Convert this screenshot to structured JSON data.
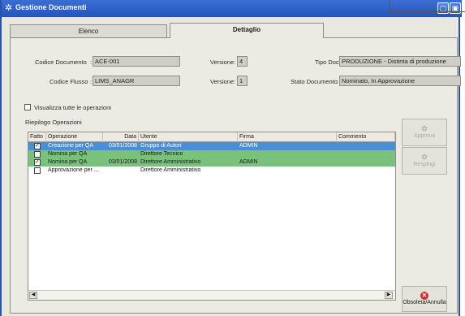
{
  "window": {
    "title": "Gestione Documenti",
    "controls": [
      "minimize-icon",
      "close-icon"
    ]
  },
  "tabs": [
    {
      "label": "Elenco",
      "active": false
    },
    {
      "label": "Dettaglio",
      "active": true
    }
  ],
  "form": {
    "codice_documento": {
      "label": "Codice Documento",
      "value": "ACE-001"
    },
    "codice_flusso": {
      "label": "Codice Flusso",
      "value": "LIMS_ANAGR"
    },
    "versione1": {
      "label": "Versione",
      "value": "4"
    },
    "versione2": {
      "label": "Versione",
      "value": "1"
    },
    "tipo_doc": {
      "label": "Tipo Doc",
      "value": "PRODUZIONE - Distinta di produzione"
    },
    "stato_documento": {
      "label": "Stato Documento",
      "value": "Nominato, In Approvazione"
    }
  },
  "visualizza_checkbox": {
    "label": "Visualizza tutte le operazioni",
    "checked": false
  },
  "riepilogo_label": "Riepilogo Operazioni",
  "table": {
    "headers": {
      "fatto": "Fatto",
      "operazione": "Operazione",
      "data": "Data",
      "utente": "Utente",
      "firma": "Firma",
      "commento": "Commento"
    },
    "rows": [
      {
        "fatto": true,
        "operazione": "Creazione per QA",
        "data": "03/01/2008",
        "utente": "Gruppo di Autori",
        "firma": "ADMIN",
        "commento": "",
        "style": "selected"
      },
      {
        "fatto": false,
        "operazione": "Nomina per QA",
        "data": "",
        "utente": "Direttore Tecnico",
        "firma": "",
        "commento": "",
        "style": "green"
      },
      {
        "fatto": true,
        "operazione": "Nomina per QA",
        "data": "03/01/2008",
        "utente": "Direttore Amministrativo",
        "firma": "ADMIN",
        "commento": "",
        "style": "green"
      },
      {
        "fatto": false,
        "operazione": "Approvazione per ...",
        "data": "",
        "utente": "Direttore Amministrativo",
        "firma": "",
        "commento": "",
        "style": "plain"
      }
    ]
  },
  "buttons": {
    "approva": {
      "label": "Approva",
      "enabled": false
    },
    "respingi": {
      "label": "Respingi",
      "enabled": false
    },
    "obsoleta": {
      "label": "Obsoleta/Annulla",
      "enabled": true
    }
  },
  "colors": {
    "selected_row": "#4a8fd6",
    "green_row": "#79c17c",
    "titlebar": "#2a5cc4"
  }
}
